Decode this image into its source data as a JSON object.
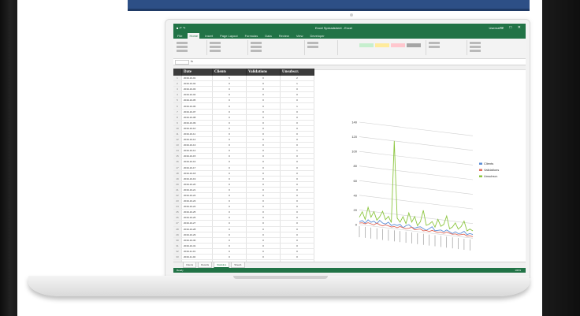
{
  "window": {
    "title": "Excel Spreadsheet - Excel",
    "user": "Username",
    "controls": "— □ ✕"
  },
  "ribbon": {
    "tabs": [
      "File",
      "Home",
      "Insert",
      "Page Layout",
      "Formulas",
      "Data",
      "Review",
      "View",
      "Developer"
    ],
    "active_tab": "Home"
  },
  "formula_bar": {
    "fx": "fx"
  },
  "table": {
    "headers": [
      "Date",
      "Clients",
      "Validations",
      "Unsubscr."
    ],
    "rows": [
      [
        "1",
        "2019-10-01",
        "5",
        "0",
        "2"
      ],
      [
        "2",
        "2019-10-02",
        "0",
        "0",
        "1"
      ],
      [
        "3",
        "2019-10-03",
        "0",
        "0",
        "0"
      ],
      [
        "4",
        "2019-10-04",
        "0",
        "0",
        "0"
      ],
      [
        "5",
        "2019-10-05",
        "0",
        "0",
        "0"
      ],
      [
        "6",
        "2019-10-06",
        "0",
        "0",
        "1"
      ],
      [
        "7",
        "2019-10-07",
        "0",
        "0",
        "0"
      ],
      [
        "8",
        "2019-10-08",
        "0",
        "0",
        "0"
      ],
      [
        "9",
        "2019-10-09",
        "0",
        "0",
        "0"
      ],
      [
        "10",
        "2019-10-10",
        "0",
        "0",
        "0"
      ],
      [
        "11",
        "2019-10-11",
        "0",
        "0",
        "0"
      ],
      [
        "12",
        "2019-10-12",
        "0",
        "0",
        "0"
      ],
      [
        "13",
        "2019-10-13",
        "0",
        "0",
        "0"
      ],
      [
        "14",
        "2019-10-14",
        "0",
        "0",
        "1"
      ],
      [
        "15",
        "2019-10-15",
        "0",
        "0",
        "0"
      ],
      [
        "16",
        "2019-10-16",
        "0",
        "0",
        "0"
      ],
      [
        "17",
        "2019-10-17",
        "0",
        "0",
        "0"
      ],
      [
        "18",
        "2019-10-18",
        "0",
        "0",
        "0"
      ],
      [
        "19",
        "2019-10-19",
        "0",
        "0",
        "0"
      ],
      [
        "20",
        "2019-10-20",
        "0",
        "0",
        "0"
      ],
      [
        "21",
        "2019-10-21",
        "0",
        "0",
        "0"
      ],
      [
        "22",
        "2019-10-22",
        "0",
        "0",
        "0"
      ],
      [
        "23",
        "2019-10-23",
        "0",
        "0",
        "0"
      ],
      [
        "24",
        "2019-10-24",
        "0",
        "0",
        "0"
      ],
      [
        "25",
        "2019-10-25",
        "0",
        "0",
        "0"
      ],
      [
        "26",
        "2019-10-26",
        "0",
        "0",
        "0"
      ],
      [
        "27",
        "2019-10-27",
        "0",
        "0",
        "0"
      ],
      [
        "28",
        "2019-10-28",
        "0",
        "0",
        "0"
      ],
      [
        "29",
        "2019-10-29",
        "0",
        "0",
        "0"
      ],
      [
        "30",
        "2019-10-30",
        "0",
        "0",
        "0"
      ],
      [
        "31",
        "2019-10-31",
        "0",
        "0",
        "0"
      ],
      [
        "32",
        "2019-11-01",
        "0",
        "0",
        "0"
      ],
      [
        "33",
        "2019-11-02",
        "0",
        "0",
        "0"
      ],
      [
        "34",
        "2019-11-03",
        "0",
        "0",
        "0"
      ],
      [
        "35",
        "2019-11-04",
        "0",
        "0",
        "0"
      ]
    ]
  },
  "sheet_tabs": [
    "Clients",
    "Results",
    "Statistics",
    "Sheet1"
  ],
  "active_sheet": "Statistics",
  "status": {
    "ready": "Ready",
    "zoom": "100%"
  },
  "colors": {
    "excel_green": "#217346",
    "series": [
      "#5b8ed6",
      "#e06b5b",
      "#8cc63f"
    ]
  },
  "chart_data": {
    "type": "line",
    "y_ticks": [
      "0",
      "20",
      "40",
      "60",
      "80",
      "100",
      "120",
      "140"
    ],
    "ylim": [
      0,
      140
    ],
    "series": [
      {
        "name": "Clients",
        "values": [
          4,
          6,
          3,
          8,
          5,
          7,
          4,
          9,
          6,
          5,
          8,
          4,
          6,
          5,
          7,
          3,
          6,
          8,
          5,
          4,
          6,
          7,
          5,
          3,
          6,
          9,
          4,
          5,
          6,
          4,
          7,
          5,
          3,
          6,
          4,
          5,
          8,
          4,
          6,
          5
        ]
      },
      {
        "name": "Validations",
        "values": [
          2,
          3,
          2,
          4,
          3,
          2,
          5,
          3,
          2,
          4,
          3,
          2,
          3,
          2,
          4,
          3,
          2,
          3,
          5,
          2,
          3,
          4,
          2,
          3,
          2,
          4,
          3,
          2,
          3,
          2,
          4,
          3,
          2,
          3,
          2,
          3,
          4,
          2,
          3,
          2
        ]
      },
      {
        "name": "Unsubscr.",
        "values": [
          10,
          18,
          8,
          25,
          12,
          20,
          9,
          14,
          22,
          11,
          16,
          8,
          120,
          15,
          10,
          18,
          9,
          24,
          12,
          20,
          8,
          14,
          30,
          10,
          12,
          16,
          9,
          20,
          11,
          14,
          26,
          9,
          12,
          18,
          10,
          14,
          22,
          9,
          12,
          10
        ]
      }
    ],
    "legend": "right"
  }
}
